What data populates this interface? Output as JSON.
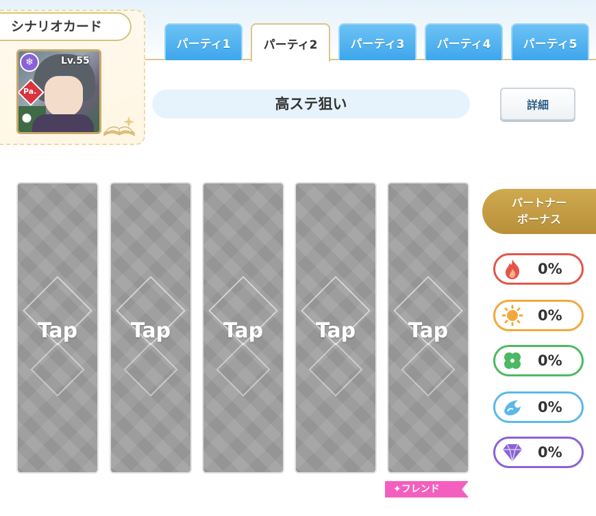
{
  "scenario_card": {
    "title": "シナリオカード",
    "level": "Lv.55",
    "type_badge": "Pa."
  },
  "tabs": [
    {
      "label": "パーティ1",
      "active": false
    },
    {
      "label": "パーティ2",
      "active": true
    },
    {
      "label": "パーティ3",
      "active": false
    },
    {
      "label": "パーティ4",
      "active": false
    },
    {
      "label": "パーティ5",
      "active": false
    }
  ],
  "party": {
    "name": "高ステ狙い",
    "detail_label": "詳細"
  },
  "slots": [
    {
      "label": "Tap"
    },
    {
      "label": "Tap"
    },
    {
      "label": "Tap"
    },
    {
      "label": "Tap"
    },
    {
      "label": "Tap"
    }
  ],
  "friend_label": "✦フレンド",
  "partner_bonus": {
    "title_line1": "パートナー",
    "title_line2": "ボーナス",
    "rows": [
      {
        "icon": "flame-icon",
        "value": "0%",
        "color": "#e2554a"
      },
      {
        "icon": "sun-icon",
        "value": "0%",
        "color": "#f2a93b"
      },
      {
        "icon": "clover-icon",
        "value": "0%",
        "color": "#4cb963"
      },
      {
        "icon": "wave-icon",
        "value": "0%",
        "color": "#5bb8e8"
      },
      {
        "icon": "diamond-icon",
        "value": "0%",
        "color": "#8a62d6"
      }
    ]
  },
  "colors": {
    "tab_inactive": "#3ea6ec",
    "gold_accent": "#c9a86a",
    "slot_gray": "#9d9d9d",
    "friend_pink": "#f35fbf"
  }
}
